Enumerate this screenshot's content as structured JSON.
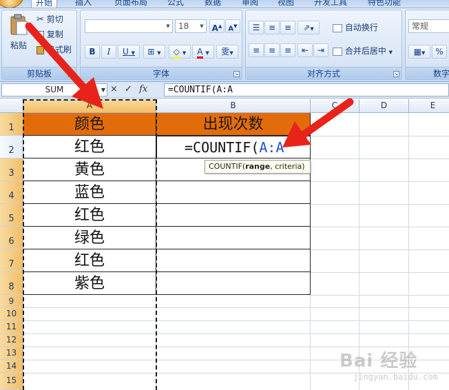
{
  "ribbon": {
    "tabs": [
      "开始",
      "插入",
      "页面布局",
      "公式",
      "数据",
      "审阅",
      "视图",
      "开发工具",
      "特色功能"
    ],
    "clipboard": {
      "paste": "粘贴",
      "cut": "剪切",
      "copy": "复制",
      "format_painter": "格式刷",
      "group_label": "剪贴板"
    },
    "font": {
      "name_value": "",
      "size_value": "18",
      "grow": "A",
      "shrink": "A",
      "bold": "B",
      "italic": "I",
      "underline": "U",
      "font_color": "A",
      "phonetic": "雯",
      "group_label": "字体"
    },
    "alignment": {
      "wrap_text": "自动换行",
      "merge_center": "合并后居中",
      "group_label": "对齐方式"
    },
    "number": {
      "format_value": "常规",
      "percent": "%",
      "group_label": "数字"
    }
  },
  "formula_bar": {
    "name_box": "SUM",
    "cancel": "×",
    "enter": "✓",
    "fx": "fx",
    "formula": "=COUNTIF(A:A"
  },
  "sheet": {
    "columns": [
      "A",
      "B",
      "C",
      "D",
      "E"
    ],
    "rows": [
      "1",
      "2",
      "3",
      "4",
      "5",
      "6",
      "7",
      "8",
      "9",
      "10",
      "11",
      "12",
      "13",
      "14",
      "15"
    ],
    "header_a": "颜色",
    "header_b": "出现次数",
    "colors": [
      "红色",
      "黄色",
      "蓝色",
      "红色",
      "绿色",
      "红色",
      "紫色"
    ],
    "editing_cell": {
      "prefix": "=COUNTIF(",
      "reference": "A:A"
    }
  },
  "tooltip": {
    "func": "COUNTIF(",
    "arg1": "range",
    "rest": ", criteria)"
  },
  "watermark": {
    "main": "Bai 经验",
    "sub": "jingyan.baidu.com"
  },
  "theme": {
    "header_fill": "#e36c0a",
    "arrow": "#e8231a",
    "reference_blue": "#1f4fd6",
    "selected_header": "#f1be68"
  }
}
